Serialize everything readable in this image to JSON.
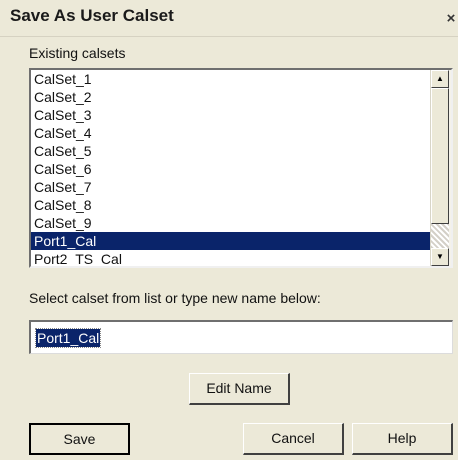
{
  "window": {
    "title": "Save As User Calset",
    "close_glyph": "×"
  },
  "existing": {
    "label": "Existing calsets",
    "items": [
      "CalSet_1",
      "CalSet_2",
      "CalSet_3",
      "CalSet_4",
      "CalSet_5",
      "CalSet_6",
      "CalSet_7",
      "CalSet_8",
      "CalSet_9",
      "Port1_Cal",
      "Port2_TS_Cal"
    ],
    "selected_index": 9
  },
  "scrollbar": {
    "up_glyph": "▲",
    "down_glyph": "▼"
  },
  "instruction": "Select calset from list or type new name below:",
  "name_input": {
    "value": "Port1_Cal"
  },
  "buttons": {
    "edit_name": "Edit Name",
    "save": "Save",
    "cancel": "Cancel",
    "help": "Help"
  }
}
